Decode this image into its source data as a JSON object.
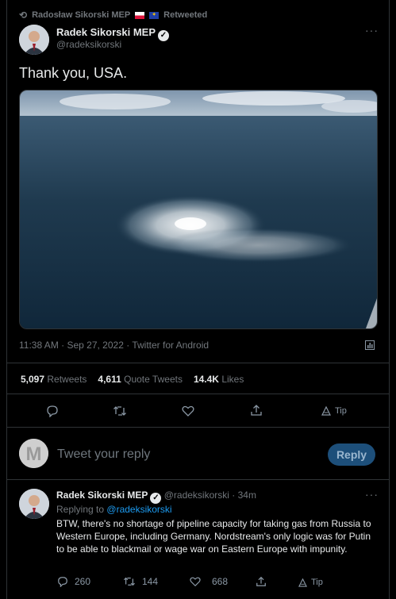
{
  "retweet_banner": {
    "name": "Radosław Sikorski MEP",
    "action": "Retweeted"
  },
  "tweet": {
    "author_name": "Radek Sikorski MEP",
    "handle": "@radeksikorski",
    "text": "Thank you, USA.",
    "timestamp": "11:38 AM · Sep 27, 2022 · Twitter for Android",
    "stats": {
      "retweets_value": "5,097",
      "retweets_label": "Retweets",
      "quotes_value": "4,611",
      "quotes_label": "Quote Tweets",
      "likes_value": "14.4K",
      "likes_label": "Likes"
    },
    "tip_label": "Tip"
  },
  "reply_composer": {
    "placeholder": "Tweet your reply",
    "button_label": "Reply"
  },
  "reply": {
    "author_name": "Radek Sikorski MEP",
    "handle": "@radeksikorski",
    "time": "· 34m",
    "replying_to_label": "Replying to",
    "replying_to_handle": "@radeksikorski",
    "text": "BTW, there's no shortage of pipeline capacity for taking gas from Russia to Western Europe, including Germany. Nordstream's only logic was for Putin to be able to blackmail or wage war on Eastern Europe with impunity.",
    "counts": {
      "replies": "260",
      "retweets": "144",
      "likes": "668"
    },
    "tip_label": "Tip"
  },
  "icons": {
    "retweet": "retweet-icon",
    "reply": "reply-icon",
    "like": "heart-icon",
    "share": "share-icon",
    "tip": "tip-icon",
    "more": "more-icon",
    "analytics": "analytics-icon",
    "verified": "verified-icon"
  }
}
